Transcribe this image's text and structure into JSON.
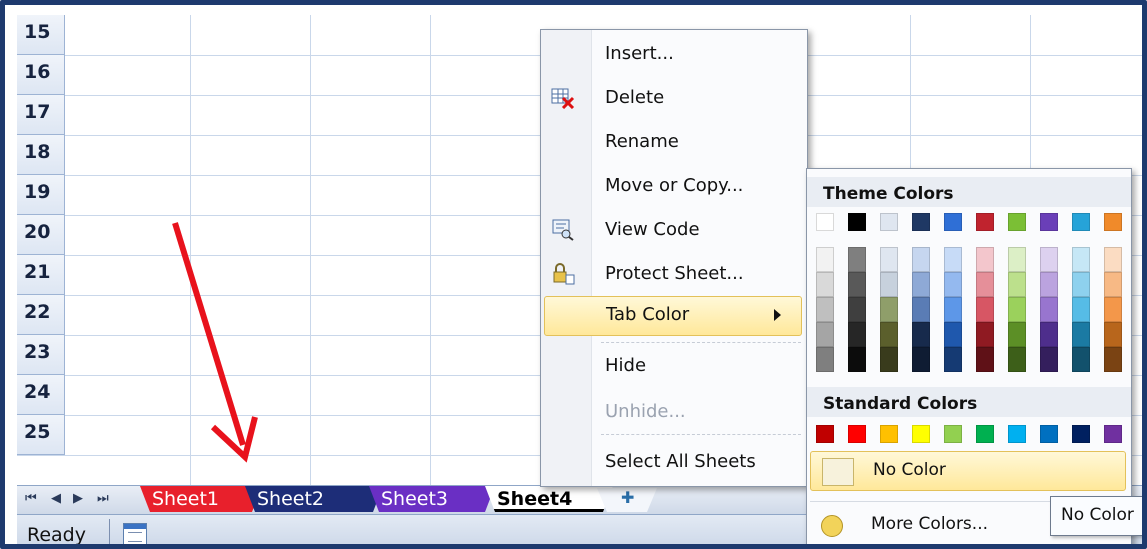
{
  "grid": {
    "row_numbers": [
      "15",
      "16",
      "17",
      "18",
      "19",
      "20",
      "21",
      "22",
      "23",
      "24",
      "25"
    ]
  },
  "tabbar": {
    "nav_first": "⏮",
    "nav_prev": "◀",
    "nav_next": "▶",
    "nav_last": "⏭",
    "sheets": [
      "Sheet1",
      "Sheet2",
      "Sheet3",
      "Sheet4"
    ],
    "new_sheet_icon": "insert-sheet-icon"
  },
  "status": {
    "ready": "Ready",
    "view_icon": "normal-view-icon"
  },
  "context_menu": {
    "insert": "Insert...",
    "delete": "Delete",
    "rename": "Rename",
    "move_copy": "Move or Copy...",
    "view_code": "View Code",
    "protect": "Protect Sheet...",
    "tab_color": "Tab Color",
    "hide": "Hide",
    "unhide": "Unhide...",
    "select_all": "Select All Sheets"
  },
  "color_menu": {
    "theme_header": "Theme Colors",
    "standard_header": "Standard Colors",
    "no_color": "No Color",
    "more_colors": "More Colors...",
    "theme_top": [
      "#ffffff",
      "#000000",
      "#dfe6f0",
      "#1f3864",
      "#2f6fd6",
      "#c0232e",
      "#7bbf35",
      "#6a3fb8",
      "#26a3d8",
      "#f08a2a"
    ],
    "theme_shades": [
      [
        "#f2f2f2",
        "#7f7f7f",
        "#dfe6f0",
        "#c6d6ef",
        "#c7dbf7",
        "#f3c6cc",
        "#dcefc6",
        "#ddd1ef",
        "#c6e7f6",
        "#fbdcc2"
      ],
      [
        "#d9d9d9",
        "#595959",
        "#c7d1dd",
        "#8ea9d6",
        "#94b9ef",
        "#e58f99",
        "#bce08c",
        "#bba3df",
        "#8ed1ee",
        "#f7b985"
      ],
      [
        "#bfbfbf",
        "#3f3f3f",
        "#8f9e6a",
        "#5a7cb5",
        "#5d97e8",
        "#d75664",
        "#9bd15c",
        "#9875cf",
        "#56bce6",
        "#f3974a"
      ],
      [
        "#a5a5a5",
        "#262626",
        "#5b5f2c",
        "#172a4c",
        "#1f58ad",
        "#8f1a22",
        "#5c8f26",
        "#4e2e8c",
        "#1b7aa3",
        "#b8661c"
      ],
      [
        "#7f7f7f",
        "#0c0c0c",
        "#393b1c",
        "#0f1c33",
        "#153a73",
        "#5f1117",
        "#3d5f19",
        "#341f5d",
        "#12516c",
        "#7a4313"
      ]
    ],
    "standard": [
      "#c00000",
      "#ff0000",
      "#ffc000",
      "#ffff00",
      "#92d050",
      "#00b050",
      "#00b0f0",
      "#0070c0",
      "#002060",
      "#7030a0"
    ]
  },
  "tooltip": "No Color"
}
